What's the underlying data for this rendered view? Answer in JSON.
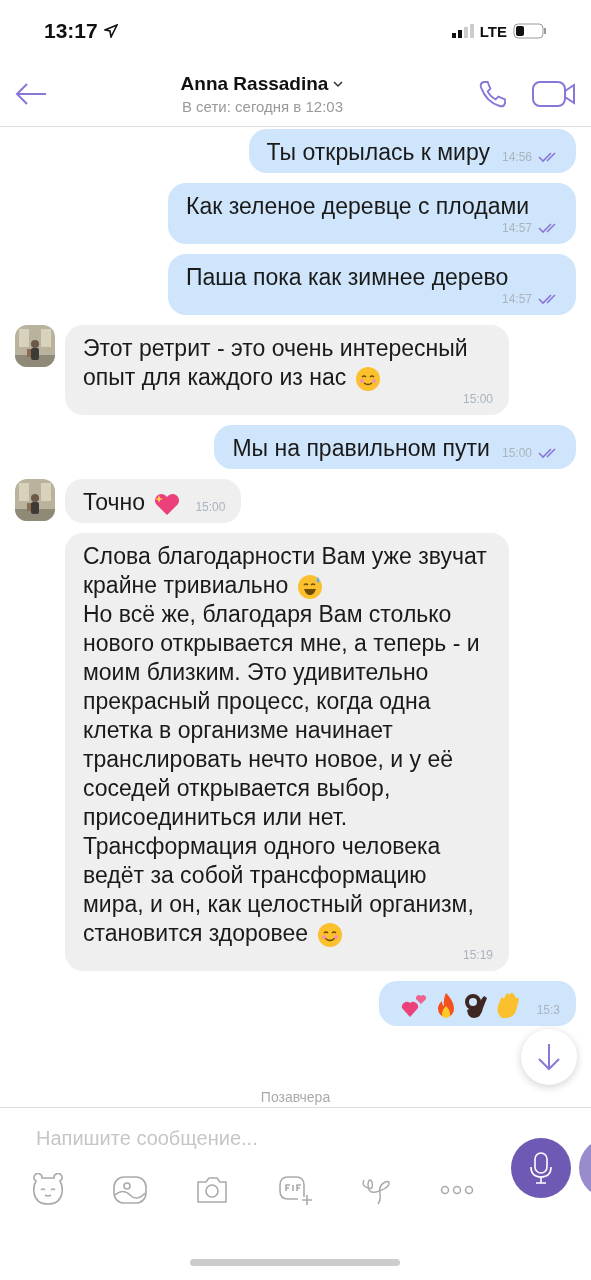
{
  "status_bar": {
    "time": "13:17",
    "network": "LTE"
  },
  "header": {
    "name": "Anna Rassadina",
    "status": "В сети: сегодня в 12:03"
  },
  "messages": [
    {
      "kind": "outgoing",
      "text": "Ты открылась к миру",
      "time": "14:56",
      "read": true
    },
    {
      "kind": "outgoing",
      "text": "Как зеленое деревце с плодами",
      "time": "14:57",
      "read": true
    },
    {
      "kind": "outgoing",
      "text": "Паша пока как зимнее дерево",
      "time": "14:57",
      "read": true
    },
    {
      "kind": "incoming",
      "avatar": true,
      "text": "Этот ретрит - это очень интересный опыт для каждого из нас",
      "emoji": [
        {
          "kind": "blush"
        }
      ],
      "time": "15:00"
    },
    {
      "kind": "outgoing",
      "text": "Мы на правильном пути",
      "time": "15:00",
      "read": true
    },
    {
      "kind": "incoming",
      "avatar": true,
      "text": "Точно",
      "emoji": [
        {
          "kind": "sparkleheart"
        }
      ],
      "time": "15:00"
    },
    {
      "kind": "incoming",
      "avatar": false,
      "text": "Слова благодарности Вам уже звучат крайне тривиально",
      "emoji": [
        {
          "kind": "sweatsmile"
        }
      ],
      "text2": "Но всё же, благодаря Вам столько нового открывается мне, а теперь - и моим близким. Это удивительно прекрасный процесс, когда одна клетка в организме начинает транслировать нечто новое, и у её соседей открывается выбор, присоединиться или нет. Трансформация одного человека ведёт за собой трансформацию мира, и он, как целостный организм, становится здоровее",
      "emoji2": [
        {
          "kind": "smile"
        }
      ],
      "time": "15:19"
    },
    {
      "kind": "outgoing",
      "emoji": [
        {
          "kind": "twohearts"
        },
        {
          "kind": "fire"
        },
        {
          "kind": "okhand"
        },
        {
          "kind": "wave"
        }
      ],
      "time": "15:3"
    }
  ],
  "date_divider": "Позавчера",
  "composer": {
    "placeholder": "Напишите сообщение..."
  }
}
